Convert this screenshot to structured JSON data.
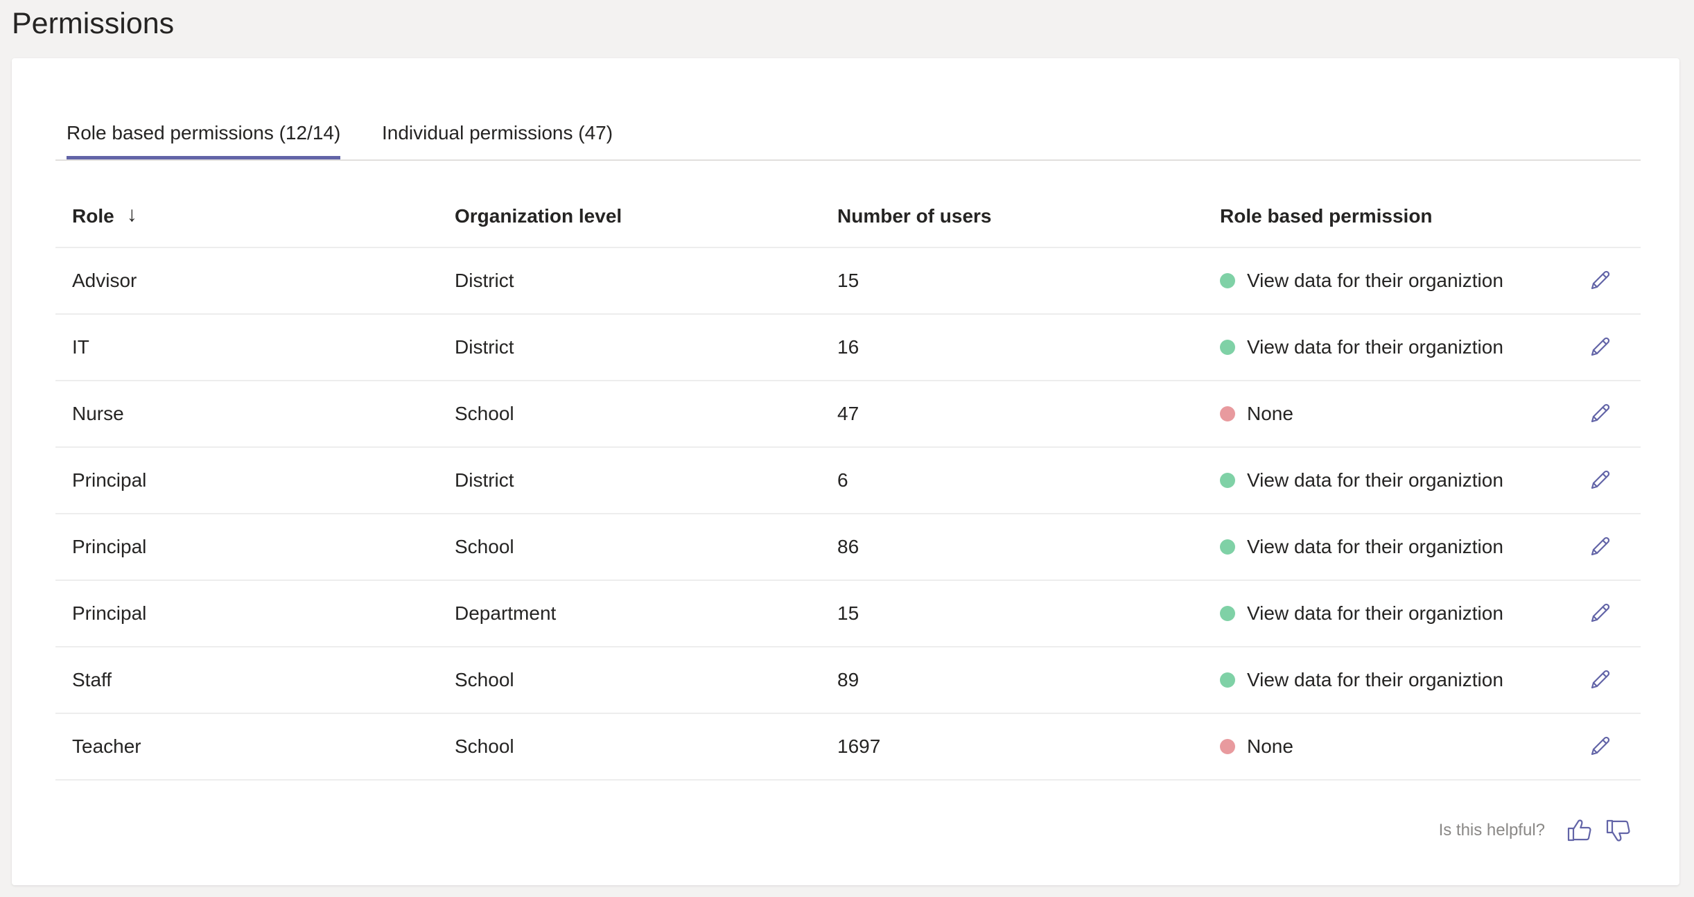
{
  "page": {
    "title": "Permissions"
  },
  "tabs": [
    {
      "label": "Role based permissions (12/14)",
      "active": true
    },
    {
      "label": "Individual permissions (47)",
      "active": false
    }
  ],
  "table": {
    "headers": {
      "role": "Role",
      "sort_icon": "arrow-down-icon",
      "organization_level": "Organization level",
      "number_of_users": "Number of users",
      "role_based_permission": "Role based permission"
    },
    "rows": [
      {
        "role": "Advisor",
        "organization_level": "District",
        "number_of_users": "15",
        "permission": "View data for their organiztion",
        "status": "granted"
      },
      {
        "role": "IT",
        "organization_level": "District",
        "number_of_users": "16",
        "permission": "View data for their organiztion",
        "status": "granted"
      },
      {
        "role": "Nurse",
        "organization_level": "School",
        "number_of_users": "47",
        "permission": "None",
        "status": "none"
      },
      {
        "role": "Principal",
        "organization_level": "District",
        "number_of_users": "6",
        "permission": "View data for their organiztion",
        "status": "granted"
      },
      {
        "role": "Principal",
        "organization_level": "School",
        "number_of_users": "86",
        "permission": "View data for their organiztion",
        "status": "granted"
      },
      {
        "role": "Principal",
        "organization_level": "Department",
        "number_of_users": "15",
        "permission": "View data for their organiztion",
        "status": "granted"
      },
      {
        "role": "Staff",
        "organization_level": "School",
        "number_of_users": "89",
        "permission": "View data for their organiztion",
        "status": "granted"
      },
      {
        "role": "Teacher",
        "organization_level": "School",
        "number_of_users": "1697",
        "permission": "None",
        "status": "none"
      }
    ],
    "row_action_icon": "pencil-edit-icon"
  },
  "feedback": {
    "label": "Is this helpful?",
    "up_icon": "thumbs-up-icon",
    "down_icon": "thumbs-down-icon"
  },
  "colors": {
    "accent": "#6264a7",
    "status_granted": "#7fd1a6",
    "status_none": "#e89a9e",
    "page_background": "#f3f2f1",
    "card_background": "#ffffff",
    "divider": "#ededed",
    "muted_text": "#8a8886"
  }
}
